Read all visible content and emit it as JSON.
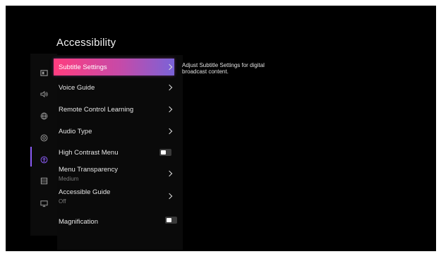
{
  "screen": {
    "title": "Accessibility",
    "description": "Adjust Subtitle Settings for digital broadcast content.",
    "accent_gradient": [
      "#ff3d7f",
      "#c64aa8",
      "#7a63d8"
    ],
    "rail_accent": "#8b5cf6"
  },
  "rail": [
    {
      "icon": "picture-icon",
      "active": false
    },
    {
      "icon": "sound-icon",
      "active": false
    },
    {
      "icon": "globe-icon",
      "active": false
    },
    {
      "icon": "support-icon",
      "active": false
    },
    {
      "icon": "accessibility-icon",
      "active": true
    },
    {
      "icon": "list-icon",
      "active": false
    },
    {
      "icon": "tv-icon",
      "active": false
    }
  ],
  "menu": {
    "subtitle_settings": "Subtitle Settings",
    "voice_guide": "Voice Guide",
    "remote_control_learning": "Remote Control Learning",
    "audio_type": "Audio Type",
    "high_contrast_menu": "High Contrast Menu",
    "high_contrast_state": "off",
    "menu_transparency": "Menu Transparency",
    "menu_transparency_value": "Medium",
    "accessible_guide": "Accessible Guide",
    "accessible_guide_value": "Off",
    "magnification": "Magnification",
    "magnification_state": "off"
  }
}
